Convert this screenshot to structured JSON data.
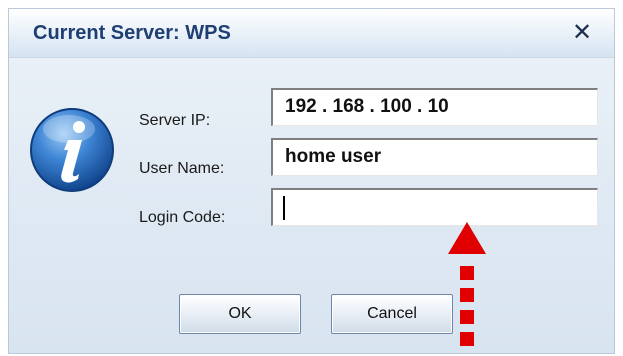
{
  "dialog": {
    "title": "Current Server: WPS",
    "close_icon": "close-icon",
    "info_icon": "info-icon",
    "colors": {
      "title": "#1f3f73",
      "background": "#dfe9f3",
      "annotation_arrow": "#e00000"
    }
  },
  "form": {
    "server_ip_label": "Server IP:",
    "server_ip_value": "192 . 168 . 100 . 10",
    "user_name_label": "User Name:",
    "user_name_value": "home user",
    "login_code_label": "Login Code:",
    "login_code_value": ""
  },
  "buttons": {
    "ok": "OK",
    "cancel": "Cancel"
  }
}
